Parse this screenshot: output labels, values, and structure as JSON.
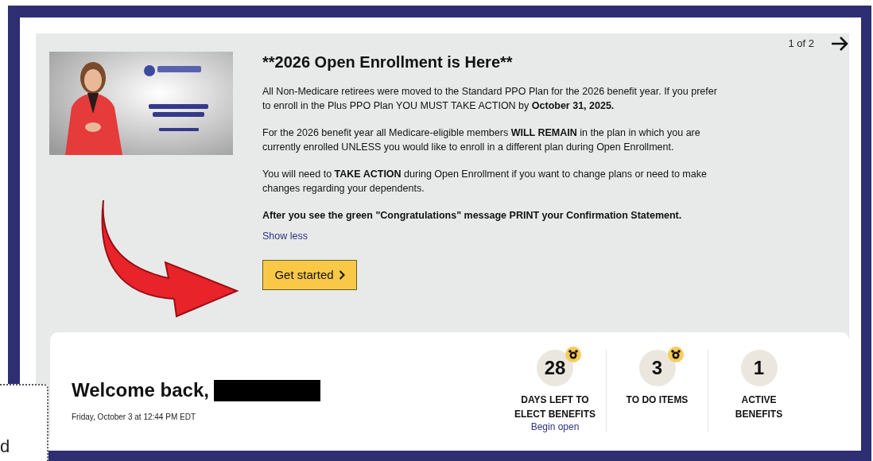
{
  "announcement": {
    "pager": "1 of 2",
    "title": "**2026 Open Enrollment is Here**",
    "paragraphs": [
      "All Non-Medicare retirees were moved to the Standard PPO Plan for the 2026 benefit year. If you prefer to enroll in the Plus PPO Plan YOU MUST TAKE ACTION by **October 31, 2025.**",
      "For the 2026 benefit year all Medicare-eligible members **WILL REMAIN** in the plan in which you are currently enrolled UNLESS you would like to enroll in a different plan during Open Enrollment.",
      "You will need to **TAKE ACTION** during Open Enrollment if you want to change plans or need to make changes regarding your dependents.",
      "**After you see the green \"Congratulations\" message PRINT your Confirmation Statement.**"
    ],
    "show_less": "Show less",
    "button": "Get started"
  },
  "welcome": {
    "greeting": "Welcome back,",
    "date": "Friday, October 3 at 12:44 PM EDT"
  },
  "stats": [
    {
      "value": "28",
      "label": "DAYS LEFT TO ELECT BENEFITS",
      "alarm": true,
      "link": "Begin open"
    },
    {
      "value": "3",
      "label": "TO DO ITEMS",
      "alarm": true
    },
    {
      "value": "1",
      "label": "ACTIVE BENEFITS",
      "alarm": false
    }
  ],
  "side_note": "d"
}
